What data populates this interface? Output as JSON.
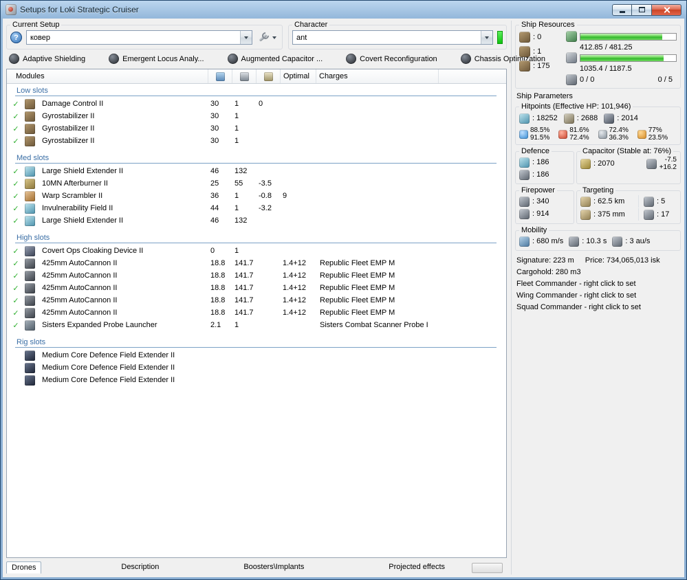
{
  "colors": {
    "progress_green": "#3fbf3f",
    "checkmark_green": "#2faf2f",
    "section_header_blue": "#3a6ea5",
    "character_status_green": "#22dd22",
    "titlebar_blue": "#93b7da"
  },
  "window": {
    "title": "Setups for Loki Strategic Cruiser"
  },
  "setup": {
    "group_label": "Current Setup",
    "help_glyph": "?",
    "value": "ковер"
  },
  "character": {
    "group_label": "Character",
    "value": "ant"
  },
  "subsystems": [
    {
      "label": "Adaptive Shielding"
    },
    {
      "label": "Emergent Locus Analy..."
    },
    {
      "label": "Augmented Capacitor ..."
    },
    {
      "label": "Covert Reconfiguration"
    },
    {
      "label": "Chassis Optimization"
    }
  ],
  "modules": {
    "columns": {
      "modules": "Modules",
      "optimal": "Optimal",
      "charges": "Charges"
    },
    "sections": [
      {
        "title": "Low slots",
        "rows": [
          {
            "check": "✓",
            "icon": "damage-control",
            "name": "Damage Control II",
            "cpu": "30",
            "pg": "1",
            "cap": "0",
            "optimal": "",
            "charge": ""
          },
          {
            "check": "✓",
            "icon": "gyrostabilizer",
            "name": "Gyrostabilizer II",
            "cpu": "30",
            "pg": "1",
            "cap": "",
            "optimal": "",
            "charge": ""
          },
          {
            "check": "✓",
            "icon": "gyrostabilizer",
            "name": "Gyrostabilizer II",
            "cpu": "30",
            "pg": "1",
            "cap": "",
            "optimal": "",
            "charge": ""
          },
          {
            "check": "✓",
            "icon": "gyrostabilizer",
            "name": "Gyrostabilizer II",
            "cpu": "30",
            "pg": "1",
            "cap": "",
            "optimal": "",
            "charge": ""
          }
        ]
      },
      {
        "title": "Med slots",
        "rows": [
          {
            "check": "✓",
            "icon": "shield-extender",
            "name": "Large Shield Extender II",
            "cpu": "46",
            "pg": "132",
            "cap": "",
            "optimal": "",
            "charge": ""
          },
          {
            "check": "✓",
            "icon": "afterburner",
            "name": "10MN Afterburner II",
            "cpu": "25",
            "pg": "55",
            "cap": "-3.5",
            "optimal": "",
            "charge": ""
          },
          {
            "check": "✓",
            "icon": "warp-scrambler",
            "name": "Warp Scrambler II",
            "cpu": "36",
            "pg": "1",
            "cap": "-0.8",
            "optimal": "9",
            "charge": ""
          },
          {
            "check": "✓",
            "icon": "invulnerability-field",
            "name": "Invulnerability Field II",
            "cpu": "44",
            "pg": "1",
            "cap": "-3.2",
            "optimal": "",
            "charge": ""
          },
          {
            "check": "✓",
            "icon": "shield-extender",
            "name": "Large Shield Extender II",
            "cpu": "46",
            "pg": "132",
            "cap": "",
            "optimal": "",
            "charge": ""
          }
        ]
      },
      {
        "title": "High slots",
        "rows": [
          {
            "check": "✓",
            "icon": "cloaking-device",
            "name": "Covert Ops Cloaking Device II",
            "cpu": "0",
            "pg": "1",
            "cap": "",
            "optimal": "",
            "charge": ""
          },
          {
            "check": "✓",
            "icon": "autocannon",
            "name": "425mm AutoCannon II",
            "cpu": "18.8",
            "pg": "141.7",
            "cap": "",
            "optimal": "1.4+12",
            "charge": "Republic Fleet EMP M"
          },
          {
            "check": "✓",
            "icon": "autocannon",
            "name": "425mm AutoCannon II",
            "cpu": "18.8",
            "pg": "141.7",
            "cap": "",
            "optimal": "1.4+12",
            "charge": "Republic Fleet EMP M"
          },
          {
            "check": "✓",
            "icon": "autocannon",
            "name": "425mm AutoCannon II",
            "cpu": "18.8",
            "pg": "141.7",
            "cap": "",
            "optimal": "1.4+12",
            "charge": "Republic Fleet EMP M"
          },
          {
            "check": "✓",
            "icon": "autocannon",
            "name": "425mm AutoCannon II",
            "cpu": "18.8",
            "pg": "141.7",
            "cap": "",
            "optimal": "1.4+12",
            "charge": "Republic Fleet EMP M"
          },
          {
            "check": "✓",
            "icon": "autocannon",
            "name": "425mm AutoCannon II",
            "cpu": "18.8",
            "pg": "141.7",
            "cap": "",
            "optimal": "1.4+12",
            "charge": "Republic Fleet EMP M"
          },
          {
            "check": "✓",
            "icon": "probe-launcher",
            "name": "Sisters Expanded Probe Launcher",
            "cpu": "2.1",
            "pg": "1",
            "cap": "",
            "optimal": "",
            "charge": "Sisters Combat Scanner Probe I"
          }
        ]
      },
      {
        "title": "Rig slots",
        "rows": [
          {
            "check": "",
            "icon": "rig-extender",
            "name": "Medium Core Defence Field Extender II",
            "cpu": "",
            "pg": "",
            "cap": "",
            "optimal": "",
            "charge": ""
          },
          {
            "check": "",
            "icon": "rig-extender",
            "name": "Medium Core Defence Field Extender II",
            "cpu": "",
            "pg": "",
            "cap": "",
            "optimal": "",
            "charge": ""
          },
          {
            "check": "",
            "icon": "rig-extender",
            "name": "Medium Core Defence Field Extender II",
            "cpu": "",
            "pg": "",
            "cap": "",
            "optimal": "",
            "charge": ""
          }
        ]
      }
    ]
  },
  "resources": {
    "group_label": "Ship Resources",
    "turrets": ": 0",
    "launchers": ": 1",
    "calibration": ": 175",
    "cpu": {
      "text": "412.85 / 481.25",
      "pct": 85.8
    },
    "powergrid": {
      "text": "1035.4 / 1187.5",
      "pct": 87.2
    },
    "drones": {
      "bandwidth": "0 / 0",
      "slots": "0 / 5"
    }
  },
  "parameters": {
    "label": "Ship Parameters",
    "hitpoints": {
      "group_label": "Hitpoints (Effective HP: 101,946)",
      "shield": ": 18252",
      "armor": ": 2688",
      "structure": ": 2014",
      "resists": [
        {
          "type": "em",
          "shield": "88.5%",
          "armor": "91.5%"
        },
        {
          "type": "thermal",
          "shield": "81.6%",
          "armor": "72.4%"
        },
        {
          "type": "kinetic",
          "shield": "72.4%",
          "armor": "36.3%"
        },
        {
          "type": "explosive",
          "shield": "77%",
          "armor": "23.5%"
        }
      ]
    },
    "defence": {
      "group_label": "Defence",
      "shield_recharge": ": 186",
      "passive_defence": ": 186"
    },
    "capacitor": {
      "group_label": "Capacitor (Stable at: 76%)",
      "amount": ": 2070",
      "usage": "-7.5",
      "recharge": "+16.2"
    },
    "firepower": {
      "group_label": "Firepower",
      "dps": ": 340",
      "volley": ": 914"
    },
    "targeting": {
      "group_label": "Targeting",
      "range": ": 62.5 km",
      "max_targets": ": 5",
      "scan_resolution": ": 375 mm",
      "sensor_strength": ": 17"
    },
    "mobility": {
      "group_label": "Mobility",
      "max_velocity": ": 680 m/s",
      "align_time": ": 10.3 s",
      "warp_speed": ": 3 au/s"
    },
    "signature": "Signature: 223 m",
    "price": "Price: 734,065,013 isk",
    "cargohold": "Cargohold: 280 m3",
    "fleet_commander": "Fleet Commander - right click to set",
    "wing_commander": "Wing Commander - right click to set",
    "squad_commander": "Squad Commander - right click to set"
  },
  "bottom_tabs": [
    {
      "label": "Drones",
      "active": true
    },
    {
      "label": "Description",
      "active": false
    },
    {
      "label": "Boosters\\Implants",
      "active": false
    },
    {
      "label": "Projected effects",
      "active": false
    }
  ],
  "bottom_button": {
    "label": ""
  }
}
